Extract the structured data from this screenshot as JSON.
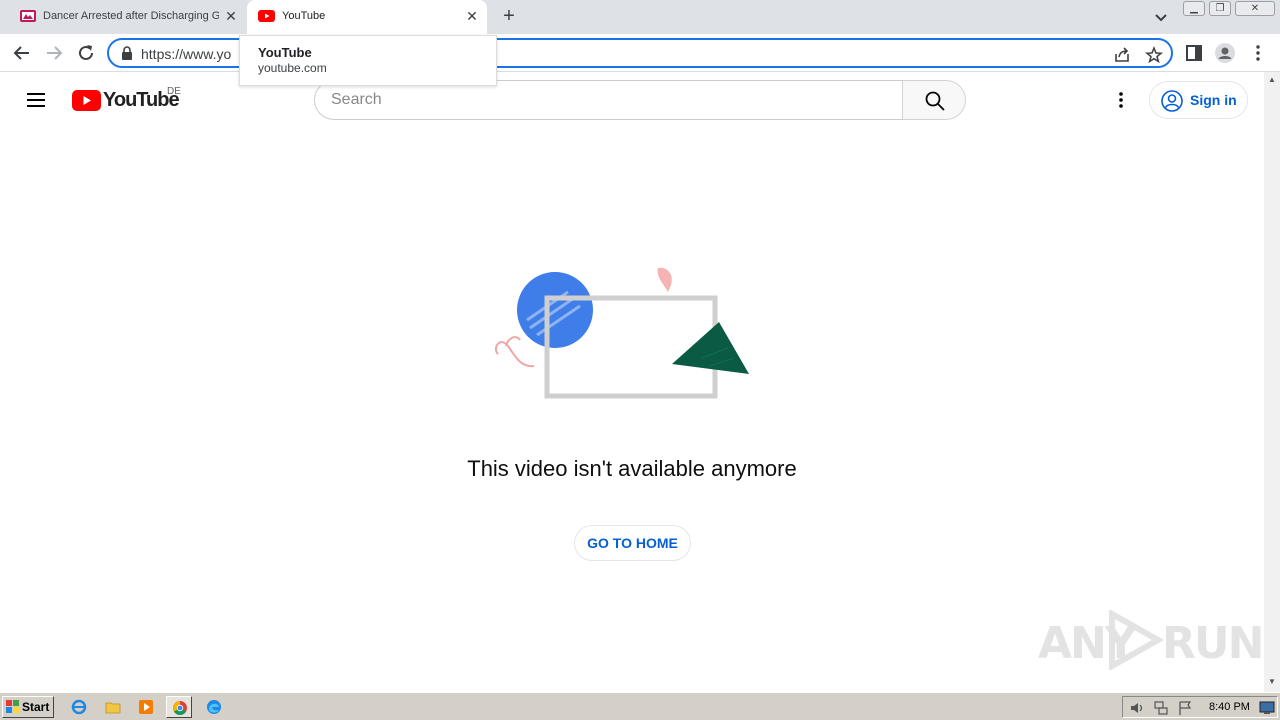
{
  "browser": {
    "tabs": [
      {
        "title": "Dancer Arrested after Discharging G",
        "active": false
      },
      {
        "title": "YouTube",
        "active": true
      }
    ],
    "new_tab_symbol": "+",
    "close_symbol": "✕",
    "address": "https://www.yo",
    "hover_card": {
      "title": "YouTube",
      "domain": "youtube.com"
    }
  },
  "youtube": {
    "logo_text": "YouTube",
    "country_code": "DE",
    "search_placeholder": "Search",
    "sign_in_label": "Sign in",
    "error_message": "This video isn't available anymore",
    "home_button_label": "GO TO HOME"
  },
  "colors": {
    "accent_blue": "#065fd4",
    "youtube_red": "#ff0000",
    "focus_blue": "#1a73e8"
  },
  "taskbar": {
    "start_label": "Start",
    "clock": "8:40 PM"
  },
  "watermark": {
    "text_left": "ANY",
    "text_right": "RUN"
  }
}
